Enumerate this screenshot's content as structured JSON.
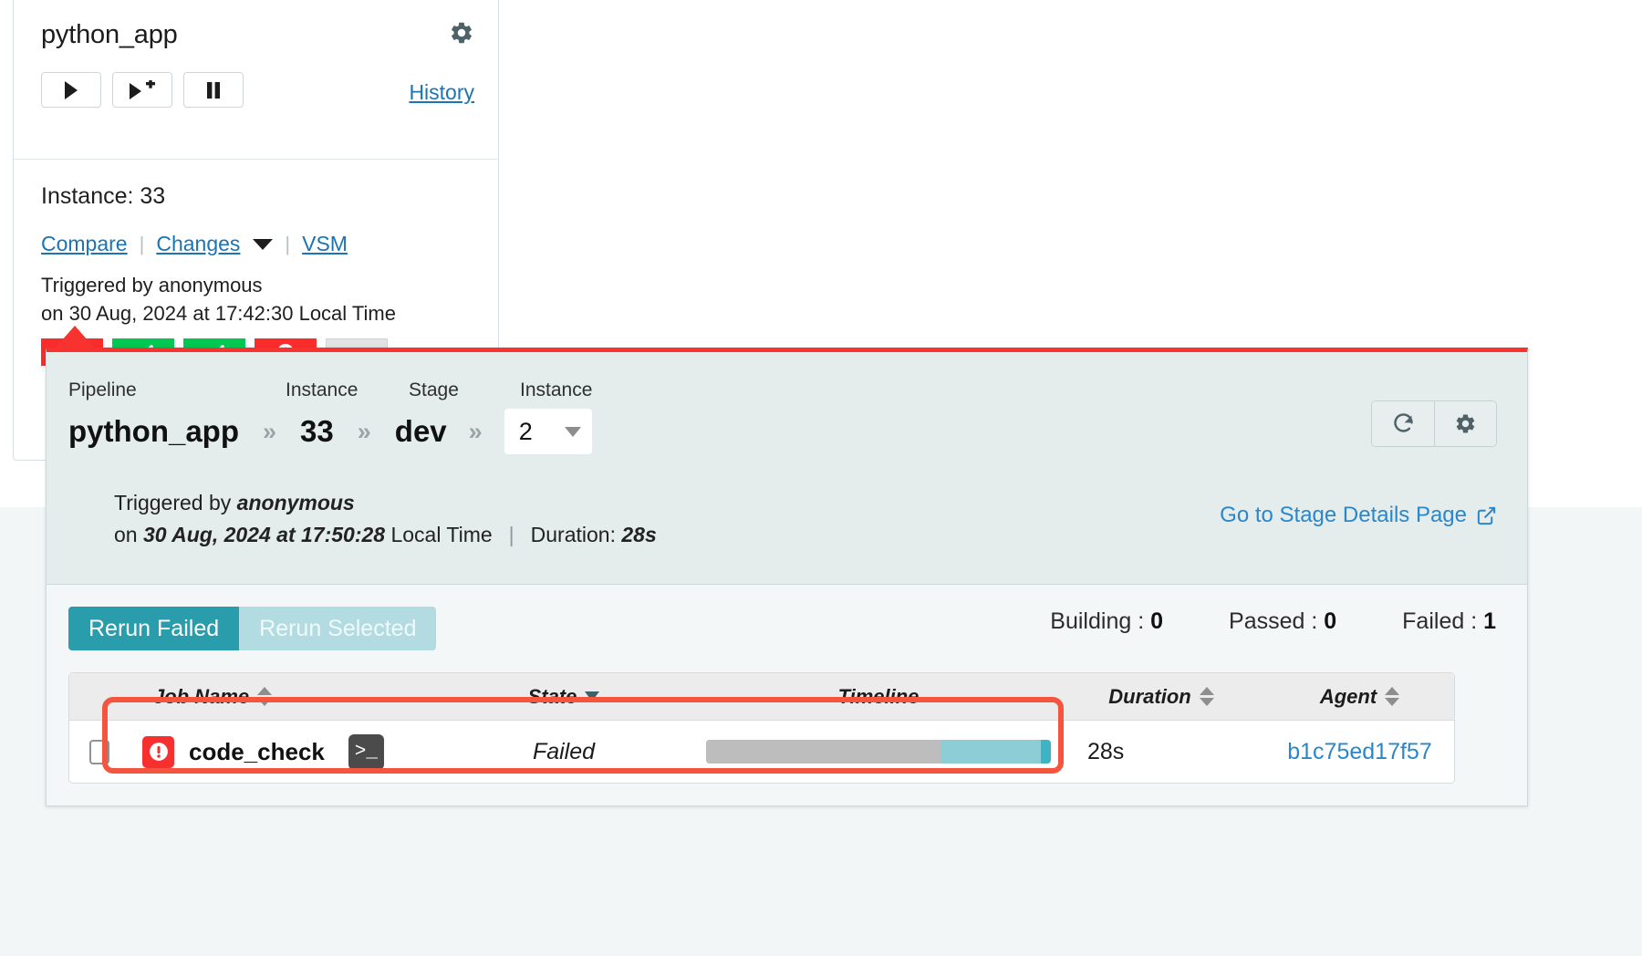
{
  "pipeline_card": {
    "title": "python_app",
    "gear_icon": "gear-icon",
    "actions": [
      {
        "name": "trigger-button",
        "icon": "play-icon"
      },
      {
        "name": "trigger-with-options-button",
        "icon": "play-plus-icon"
      },
      {
        "name": "pause-button",
        "icon": "pause-icon"
      }
    ],
    "history_link": "History",
    "instance_label": "Instance: 33",
    "links": {
      "compare": "Compare",
      "changes": "Changes",
      "vsm": "VSM"
    },
    "separator": "|",
    "triggered_by": "Triggered by anonymous",
    "triggered_on": "on 30 Aug, 2024 at 17:42:30 Local Time",
    "stages": [
      {
        "name": "stage-status-1",
        "status": "failed"
      },
      {
        "name": "stage-status-2",
        "status": "passed"
      },
      {
        "name": "stage-status-3",
        "status": "passed"
      },
      {
        "name": "stage-status-4",
        "status": "failed"
      },
      {
        "name": "stage-status-5",
        "status": "unknown"
      }
    ]
  },
  "popup": {
    "accent_color": "#f7322f",
    "breadcrumb": {
      "pipeline_label": "Pipeline",
      "pipeline_value": "python_app",
      "instance_label": "Instance",
      "instance_value": "33",
      "stage_label": "Stage",
      "stage_value": "dev",
      "stage_instance_label": "Instance",
      "stage_instance_value": "2",
      "chevron": "»"
    },
    "triggered_prefix": "Triggered by ",
    "triggered_user": "anonymous",
    "on_prefix": "on ",
    "on_datetime": "30 Aug, 2024 at 17:50:28",
    "on_suffix": " Local Time",
    "divider": "|",
    "duration_label": "Duration: ",
    "duration_value": "28s",
    "tools": [
      {
        "name": "refresh-button",
        "icon": "refresh-icon"
      },
      {
        "name": "settings-button",
        "icon": "gear-icon"
      }
    ],
    "stage_details_link": "Go to Stage Details Page",
    "stage_details_icon": "external-link-icon"
  },
  "jobs": {
    "rerun_failed_label": "Rerun Failed",
    "rerun_selected_label": "Rerun Selected",
    "counts": [
      {
        "label": "Building :",
        "value": "0"
      },
      {
        "label": "Passed :",
        "value": "0"
      },
      {
        "label": "Failed :",
        "value": "1"
      }
    ],
    "columns": [
      {
        "label": "Job Name",
        "sort": "both"
      },
      {
        "label": "State",
        "sort": "desc"
      },
      {
        "label": "Timeline",
        "sort": "none"
      },
      {
        "label": "Duration",
        "sort": "both"
      },
      {
        "label": "Agent",
        "sort": "both"
      }
    ],
    "rows": [
      {
        "status": "failed",
        "status_icon": "error-icon",
        "name": "code_check",
        "console_icon": ">_",
        "state": "Failed",
        "timeline": {
          "waiting_pct": 68,
          "building_pct": 29,
          "tip_pct": 3
        },
        "duration": "28s",
        "agent": "b1c75ed17f57"
      }
    ]
  }
}
